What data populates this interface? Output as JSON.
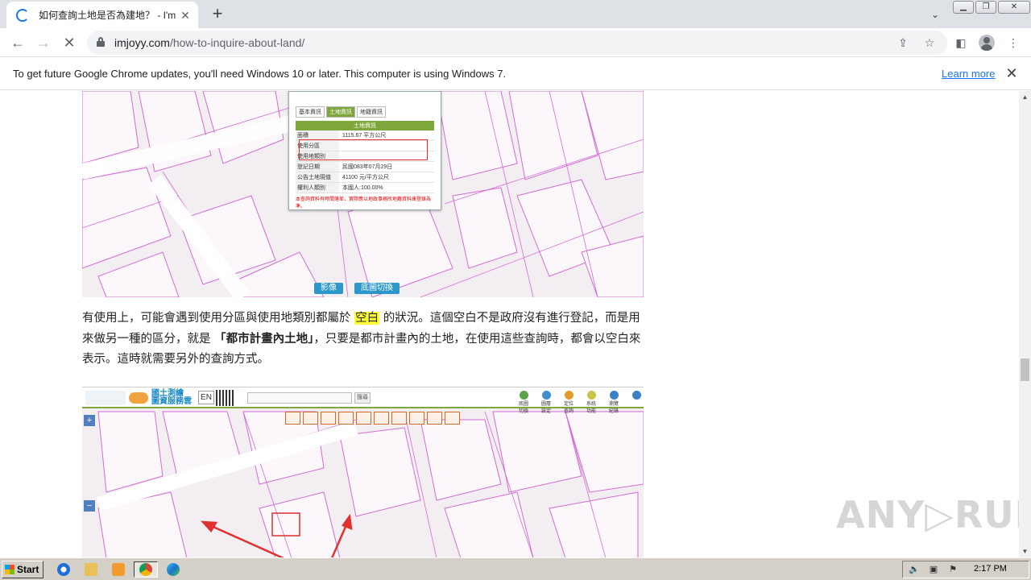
{
  "browser": {
    "tab_title": "如何查詢土地是否為建地？ - I'm Joy",
    "tab_close": "✕",
    "new_tab": "+",
    "url_domain": "imjoyy.com",
    "url_path": "/how-to-inquire-about-land/"
  },
  "infobar": {
    "message": "To get future Google Chrome updates, you'll need Windows 10 or later. This computer is using Windows 7.",
    "link": "Learn more",
    "close": "✕"
  },
  "article": {
    "para_a": "有使用上，可能會遇到使用分區與使用地類別都屬於 ",
    "para_highlight": "空白",
    "para_b": " 的狀況。這個空白不是政府沒有進行登記，而是用來做另一種的區分，就是 ",
    "para_bold": "「都市計畫內土地」",
    "para_c": "，只要是都市計畫內的土地，在使用這些查詢時，都會以空白來表示。這時就需要另外的查詢方式。"
  },
  "map1": {
    "popup": {
      "tabs": [
        "基本資訊",
        "土地資訊",
        "地籍資訊"
      ],
      "header": "土地資訊",
      "rows": [
        {
          "k": "面積",
          "v": "1115.67 平方公尺"
        },
        {
          "k": "使用分區",
          "v": ""
        },
        {
          "k": "使用地類別",
          "v": ""
        },
        {
          "k": "登記日期",
          "v": "民國083年07月29日"
        },
        {
          "k": "公告土地現值",
          "v": "41100 元/平方公尺"
        },
        {
          "k": "權利人類別",
          "v": "本國人:100.00%"
        }
      ],
      "note": "本查詢資料有時間落差，實際應以地政事務所地籍資料庫登錄為準。"
    },
    "buttons": [
      "影像",
      "底圖切換"
    ]
  },
  "map2": {
    "logo_line1": "國土測繪",
    "logo_line2": "圖資服務雲",
    "en": "EN",
    "search_btn": "搜尋",
    "tools": [
      "底圖切換",
      "圖層設定",
      "定位查詢",
      "系統功能",
      "瀏覽紀錄"
    ],
    "zoom_in": "+",
    "zoom_out": "−"
  },
  "watermark": "ANY▷RUN",
  "taskbar": {
    "start": "Start",
    "clock": "2:17 PM"
  },
  "colors": {
    "accent_blue": "#1a73e8",
    "map_lines": "#d36bd6",
    "highlight": "#ffff33"
  }
}
